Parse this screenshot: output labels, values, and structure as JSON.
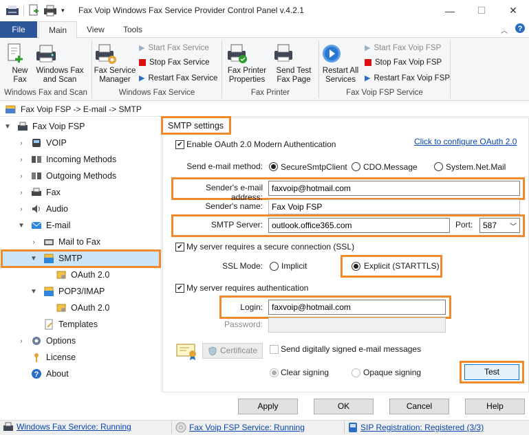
{
  "window": {
    "title": "Fax Voip Windows Fax Service Provider Control Panel v.4.2.1",
    "minimize": "—",
    "maximize": "☐",
    "close": "✕"
  },
  "ribbon_tabs": [
    "File",
    "Main",
    "View",
    "Tools"
  ],
  "ribbon": {
    "new_fax": "New\nFax",
    "windows_fax_and_scan": "Windows Fax\nand Scan",
    "group1_label": "Windows Fax and Scan",
    "fax_service_manager": "Fax Service\nManager",
    "start_fax_service": "Start Fax Service",
    "stop_fax_service": "Stop Fax Service",
    "restart_fax_service": "Restart Fax Service",
    "group2_label": "Windows Fax Service",
    "fax_printer_properties": "Fax Printer\nProperties",
    "send_test_fax_page": "Send Test\nFax Page",
    "group3_label": "Fax Printer",
    "restart_all_services": "Restart All\nServices",
    "start_fax_voip_fsp": "Start Fax Voip FSP",
    "stop_fax_voip_fsp": "Stop Fax Voip FSP",
    "restart_fax_voip_fsp": "Restart Fax Voip FSP",
    "group4_label": "Fax Voip FSP Service"
  },
  "breadcrumb": "Fax Voip FSP -> E-mail -> SMTP",
  "tree": [
    {
      "label": "Fax Voip FSP",
      "level": 0,
      "expanded": true
    },
    {
      "label": "VOIP",
      "level": 1
    },
    {
      "label": "Incoming Methods",
      "level": 1
    },
    {
      "label": "Outgoing Methods",
      "level": 1
    },
    {
      "label": "Fax",
      "level": 1
    },
    {
      "label": "Audio",
      "level": 1
    },
    {
      "label": "E-mail",
      "level": 1,
      "expanded": true
    },
    {
      "label": "Mail to Fax",
      "level": 2
    },
    {
      "label": "SMTP",
      "level": 2,
      "expanded": true,
      "selected": true
    },
    {
      "label": "OAuth 2.0",
      "level": 3
    },
    {
      "label": "POP3/IMAP",
      "level": 2,
      "expanded": true
    },
    {
      "label": "OAuth 2.0",
      "level": 3
    },
    {
      "label": "Templates",
      "level": 2
    },
    {
      "label": "Options",
      "level": 1
    },
    {
      "label": "License",
      "level": 1
    },
    {
      "label": "About",
      "level": 1
    }
  ],
  "smtp": {
    "section_title": "SMTP settings",
    "enable_oauth": "Enable OAuth 2.0 Modern Authentication",
    "configure_oauth_link": "Click to configure OAuth 2.0",
    "send_method_label": "Send e-mail method:",
    "send_methods": [
      "SecureSmtpClient",
      "CDO.Message",
      "System.Net.Mail"
    ],
    "sender_email_label": "Sender's e-mail address:",
    "sender_email_value": "faxvoip@hotmail.com",
    "sender_name_label": "Sender's name:",
    "sender_name_value": "Fax Voip FSP",
    "smtp_server_label": "SMTP Server:",
    "smtp_server_value": "outlook.office365.com",
    "port_label": "Port:",
    "port_value": "587",
    "ssl_checkbox": "My server requires a secure connection (SSL)",
    "ssl_mode_label": "SSL Mode:",
    "ssl_implicit": "Implicit",
    "ssl_explicit": "Explicit (STARTTLS)",
    "auth_checkbox": "My server requires authentication",
    "login_label": "Login:",
    "login_value": "faxvoip@hotmail.com",
    "password_label": "Password:",
    "certificate_button": "Certificate",
    "sign_checkbox": "Send digitally signed e-mail messages",
    "clear_signing": "Clear signing",
    "opaque_signing": "Opaque signing",
    "test_button": "Test"
  },
  "buttons": {
    "apply": "Apply",
    "ok": "OK",
    "cancel": "Cancel",
    "help": "Help"
  },
  "status": {
    "windows_fax": "Windows Fax Service: Running",
    "fsp": "Fax Voip FSP Service: Running",
    "sip": "SIP Registration: Registered (3/3)"
  },
  "colors": {
    "accent": "#2b579a",
    "highlight": "#f08a2c",
    "selection": "#cce4f7",
    "link": "#0645ad"
  }
}
